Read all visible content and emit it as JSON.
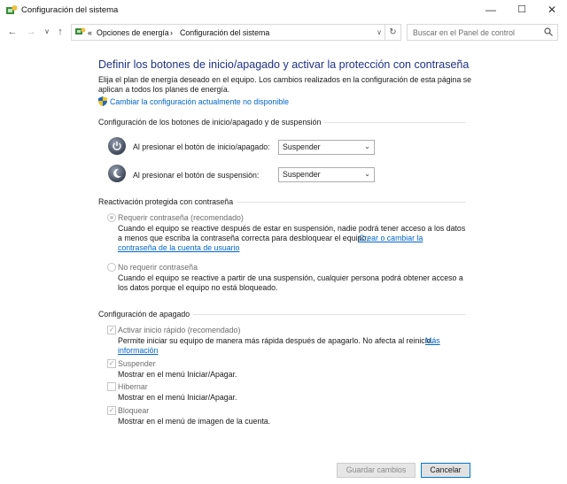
{
  "window": {
    "title": "Configuración del sistema",
    "minimize": "—",
    "maximize": "☐",
    "close": "✕"
  },
  "nav": {
    "back": "←",
    "forward": "→",
    "down": "∨",
    "up": "↑",
    "breadcrumb_prefix": "«",
    "breadcrumbs": [
      "Opciones de energía",
      "Configuración del sistema"
    ],
    "separator": "›",
    "dropdown": "∨",
    "refresh": "↻",
    "search_placeholder": "Buscar en el Panel de control"
  },
  "page": {
    "heading": "Definir los botones de inicio/apagado y activar la protección con contraseña",
    "intro_1": "Elija el plan de energía deseado en el equipo. Los cambios realizados en la configuración de esta página se",
    "intro_2": "aplican a todos los planes de energía.",
    "change_settings_link": "Cambiar la configuración actualmente no disponible"
  },
  "power_buttons": {
    "section": "Configuración de los botones de inicio/apagado y de suspensión",
    "power_label": "Al presionar el botón de inicio/apagado:",
    "power_value": "Suspender",
    "sleep_label": "Al presionar el botón de suspensión:",
    "sleep_value": "Suspender",
    "chevron": "⌄"
  },
  "password": {
    "section": "Reactivación protegida con contraseña",
    "require_label": "Requerir contraseña (recomendado)",
    "require_desc_1": "Cuando el equipo se reactive después de estar en suspensión, nadie podrá tener acceso a los datos",
    "require_desc_2": "a menos que escriba la contraseña correcta para desbloquear el equipo.",
    "require_link_1": "Crear o cambiar la",
    "require_link_2": "contraseña de la cuenta de usuario",
    "norequire_label": "No requerir contraseña",
    "norequire_desc_1": "Cuando el equipo se reactive a partir de una suspensión, cualquier persona podrá obtener acceso a",
    "norequire_desc_2": "los datos porque el equipo no está bloqueado."
  },
  "shutdown": {
    "section": "Configuración de apagado",
    "check": "✓",
    "fast_label": "Activar inicio rápido (recomendado)",
    "fast_desc": "Permite iniciar su equipo de manera más rápida después de apagarlo. No afecta al reinicio.",
    "fast_link_1": "Más",
    "fast_link_2": "información",
    "suspend_label": "Suspender",
    "suspend_desc": "Mostrar en el menú Iniciar/Apagar.",
    "hibernate_label": "Hibernar",
    "hibernate_desc": "Mostrar en el menú Iniciar/Apagar.",
    "lock_label": "Bloquear",
    "lock_desc": "Mostrar en el menú de imagen de la cuenta."
  },
  "footer": {
    "save": "Guardar cambios",
    "cancel": "Cancelar"
  }
}
